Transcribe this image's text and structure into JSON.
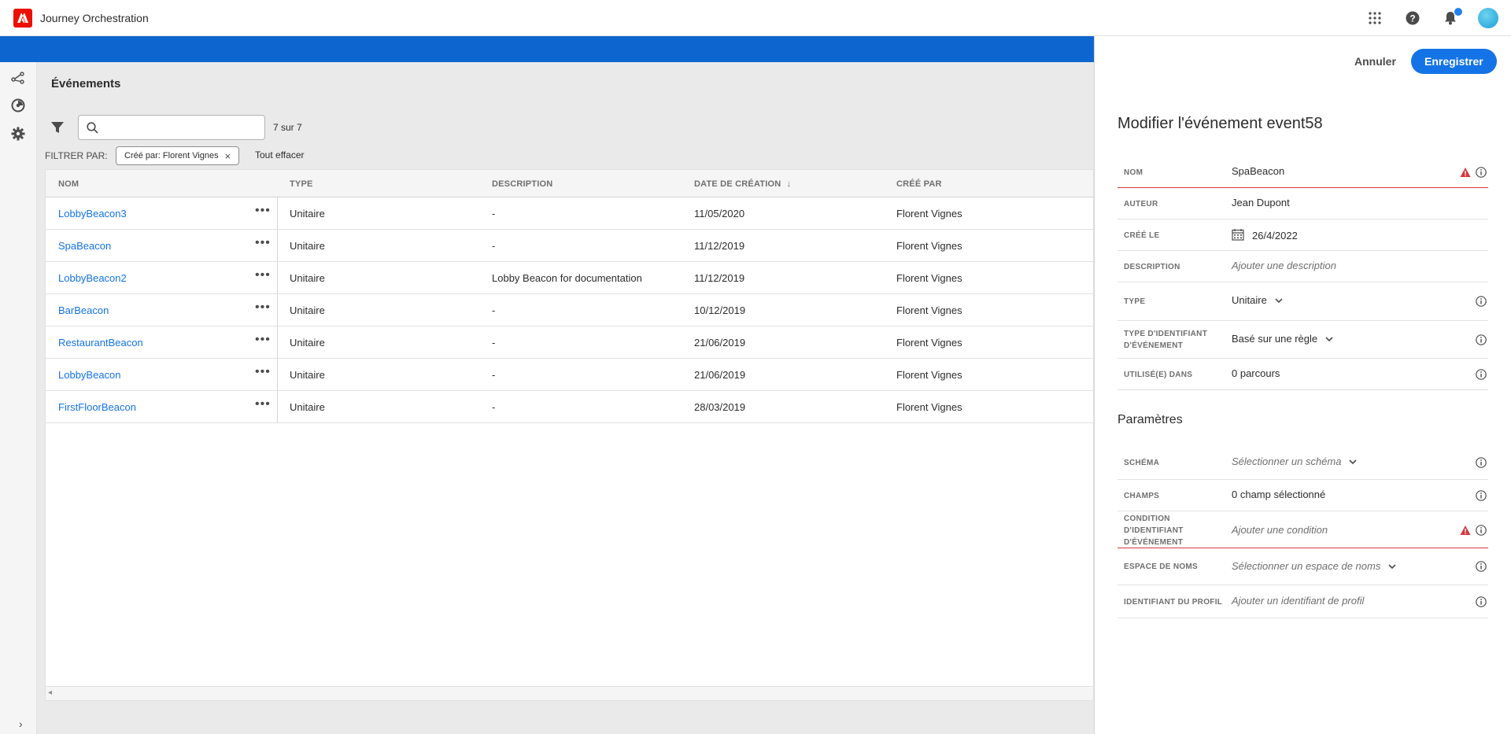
{
  "app": {
    "title": "Journey Orchestration"
  },
  "main": {
    "page_title": "Événements",
    "search_placeholder": "",
    "count": "7 sur 7",
    "filter_by_label": "FILTRER PAR:",
    "chip_label": "Créé par: Florent Vignes",
    "chip_remove": "×",
    "clear_all": "Tout effacer"
  },
  "table": {
    "columns": [
      "NOM",
      "TYPE",
      "DESCRIPTION",
      "DATE DE CRÉATION",
      "CRÉÉ PAR"
    ],
    "sort_indicator": "↓",
    "more": "•••",
    "rows": [
      {
        "name": "LobbyBeacon3",
        "type": "Unitaire",
        "description": "-",
        "date": "11/05/2020",
        "creator": "Florent Vignes"
      },
      {
        "name": "SpaBeacon",
        "type": "Unitaire",
        "description": "-",
        "date": "11/12/2019",
        "creator": "Florent Vignes"
      },
      {
        "name": "LobbyBeacon2",
        "type": "Unitaire",
        "description": "Lobby Beacon for documentation",
        "date": "11/12/2019",
        "creator": "Florent Vignes"
      },
      {
        "name": "BarBeacon",
        "type": "Unitaire",
        "description": "-",
        "date": "10/12/2019",
        "creator": "Florent Vignes"
      },
      {
        "name": "RestaurantBeacon",
        "type": "Unitaire",
        "description": "-",
        "date": "21/06/2019",
        "creator": "Florent Vignes"
      },
      {
        "name": "LobbyBeacon",
        "type": "Unitaire",
        "description": "-",
        "date": "21/06/2019",
        "creator": "Florent Vignes"
      },
      {
        "name": "FirstFloorBeacon",
        "type": "Unitaire",
        "description": "-",
        "date": "28/03/2019",
        "creator": "Florent Vignes"
      }
    ]
  },
  "panel": {
    "cancel": "Annuler",
    "save": "Enregistrer",
    "title": "Modifier l'événement event58",
    "fields": {
      "name_label": "NOM",
      "name_value": "SpaBeacon",
      "author_label": "AUTEUR",
      "author_value": "Jean Dupont",
      "created_label": "CRÉÉ LE",
      "created_value": "26/4/2022",
      "description_label": "DESCRIPTION",
      "description_placeholder": "Ajouter une description",
      "type_label": "TYPE",
      "type_value": "Unitaire",
      "id_type_label_1": "TYPE D'IDENTIFIANT",
      "id_type_label_2": "D'ÉVÉNEMENT",
      "id_type_value": "Basé sur une règle",
      "used_label": "UTILISÉ(E) DANS",
      "used_value": "0 parcours"
    },
    "params_title": "Paramètres",
    "params": {
      "schema_label": "SCHÉMA",
      "schema_placeholder": "Sélectionner un schéma",
      "fields_label": "CHAMPS",
      "fields_value": "0 champ sélectionné",
      "condition_label_1": "CONDITION",
      "condition_label_2": "D'IDENTIFIANT",
      "condition_label_3": "D'ÉVÉNEMENT",
      "condition_placeholder": "Ajouter une condition",
      "namespace_label": "ESPACE DE NOMS",
      "namespace_placeholder": "Sélectionner un espace de noms",
      "profile_id_label": "IDENTIFIANT DU PROFIL",
      "profile_id_placeholder": "Ajouter un identifiant de profil"
    }
  },
  "colors": {
    "brand_blue": "#0d66d0",
    "cta_blue": "#1473e6",
    "link_blue": "#1473e6",
    "error_red": "#d7373f",
    "adobe_red": "#eb1000"
  }
}
